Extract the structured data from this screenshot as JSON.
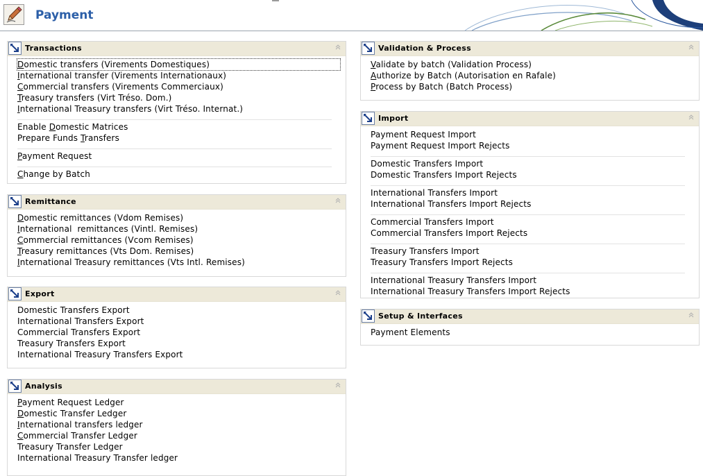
{
  "header": {
    "title": "Payment"
  },
  "colors": {
    "title": "#2c5fa8",
    "panel_header_bg": "#ede9d9",
    "swoosh": "#1d3f7a"
  },
  "panels": {
    "transactions": {
      "title": "Transactions",
      "groups": [
        [
          {
            "pre": "",
            "u": "D",
            "post": "omestic transfers (Virements Domestiques)"
          },
          {
            "pre": "",
            "u": "I",
            "post": "nternational transfer (Virements Internationaux)"
          },
          {
            "pre": "",
            "u": "C",
            "post": "ommercial transfers (Virements Commerciaux)"
          },
          {
            "pre": "",
            "u": "T",
            "post": "reasury transfers (Virt Tréso. Dom.)"
          },
          {
            "pre": "",
            "u": "I",
            "post": "nternational Treasury transfers (Virt Tréso. Internat.)"
          }
        ],
        [
          {
            "pre": "Enable ",
            "u": "D",
            "post": "omestic Matrices"
          },
          {
            "pre": "Prepare Funds ",
            "u": "T",
            "post": "ransfers"
          }
        ],
        [
          {
            "pre": "",
            "u": "P",
            "post": "ayment Request"
          }
        ],
        [
          {
            "pre": "",
            "u": "C",
            "post": "hange by Batch"
          }
        ]
      ]
    },
    "remittance": {
      "title": "Remittance",
      "groups": [
        [
          {
            "pre": "",
            "u": "D",
            "post": "omestic remittances (Vdom Remises)"
          },
          {
            "pre": "",
            "u": "I",
            "post": "nternational  remittances (Vintl. Remises)"
          },
          {
            "pre": "",
            "u": "C",
            "post": "ommercial remittances (Vcom Remises)"
          },
          {
            "pre": "",
            "u": "T",
            "post": "reasury remittances (Vts Dom. Remises)"
          },
          {
            "pre": "",
            "u": "I",
            "post": "nternational Treasury remittances (Vts Intl. Remises)"
          }
        ]
      ]
    },
    "export": {
      "title": "Export",
      "groups": [
        [
          {
            "pre": "Domestic Transfers Export",
            "u": "",
            "post": ""
          },
          {
            "pre": "International Transfers Export",
            "u": "",
            "post": ""
          },
          {
            "pre": "Commercial Transfers Export",
            "u": "",
            "post": ""
          },
          {
            "pre": "Treasury Transfers Export",
            "u": "",
            "post": ""
          },
          {
            "pre": "International Treasury Transfers Export",
            "u": "",
            "post": ""
          }
        ]
      ]
    },
    "analysis": {
      "title": "Analysis",
      "groups": [
        [
          {
            "pre": "",
            "u": "P",
            "post": "ayment Request Ledger"
          },
          {
            "pre": "",
            "u": "D",
            "post": "omestic Transfer Ledger"
          },
          {
            "pre": "",
            "u": "I",
            "post": "nternational transfers ledger"
          },
          {
            "pre": "",
            "u": "C",
            "post": "ommercial Transfer Ledger"
          },
          {
            "pre": "Treasury Transfer Ledger",
            "u": "",
            "post": ""
          },
          {
            "pre": "International Treasury Transfer ledger",
            "u": "",
            "post": ""
          }
        ]
      ]
    },
    "validation": {
      "title": "Validation & Process",
      "groups": [
        [
          {
            "pre": "",
            "u": "V",
            "post": "alidate by batch (Validation Process)"
          },
          {
            "pre": "",
            "u": "A",
            "post": "uthorize by Batch (Autorisation en Rafale)"
          },
          {
            "pre": "",
            "u": "P",
            "post": "rocess by Batch (Batch Process)"
          }
        ]
      ]
    },
    "import": {
      "title": "Import",
      "groups": [
        [
          {
            "pre": "Payment Request Import",
            "u": "",
            "post": ""
          },
          {
            "pre": "Payment Request Import Rejects",
            "u": "",
            "post": ""
          }
        ],
        [
          {
            "pre": "Domestic Transfers Import",
            "u": "",
            "post": ""
          },
          {
            "pre": "Domestic Transfers Import Rejects",
            "u": "",
            "post": ""
          }
        ],
        [
          {
            "pre": "International Transfers Import",
            "u": "",
            "post": ""
          },
          {
            "pre": "International Transfers Import Rejects",
            "u": "",
            "post": ""
          }
        ],
        [
          {
            "pre": "Commercial Transfers Import",
            "u": "",
            "post": ""
          },
          {
            "pre": "Commercial Transfers Import Rejects",
            "u": "",
            "post": ""
          }
        ],
        [
          {
            "pre": "Treasury Transfers Import",
            "u": "",
            "post": ""
          },
          {
            "pre": "Treasury Transfers Import Rejects",
            "u": "",
            "post": ""
          }
        ],
        [
          {
            "pre": "International Treasury Transfers Import",
            "u": "",
            "post": ""
          },
          {
            "pre": "International Treasury Transfers Import Rejects",
            "u": "",
            "post": ""
          }
        ]
      ]
    },
    "setup": {
      "title": "Setup & Interfaces",
      "groups": [
        [
          {
            "pre": "Payment Elements",
            "u": "",
            "post": ""
          }
        ]
      ]
    }
  }
}
